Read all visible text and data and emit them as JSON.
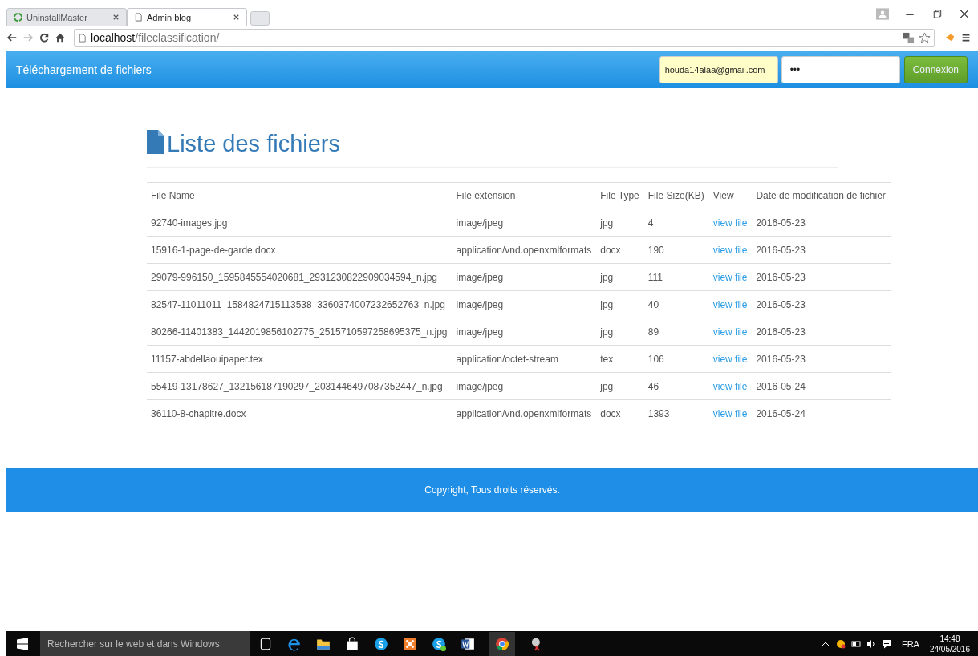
{
  "browser": {
    "tabs": [
      {
        "title": "UninstallMaster",
        "selected": false
      },
      {
        "title": "Admin blog",
        "selected": true
      }
    ],
    "address": {
      "host": "localhost",
      "path": "/fileclassification/"
    }
  },
  "navbar": {
    "brand": "Téléchargement de fichiers",
    "email": "houda14alaa@gmail.com",
    "password": "•••",
    "login_button": "Connexion"
  },
  "heading": "Liste des fichiers",
  "table": {
    "columns": [
      "File Name",
      "File extension",
      "File Type",
      "File Size(KB)",
      "View",
      "Date de modification de fichier"
    ],
    "rows": [
      [
        "92740-images.jpg",
        "image/jpeg",
        "jpg",
        "4",
        "view file",
        "2016-05-23"
      ],
      [
        "15916-1-page-de-garde.docx",
        "application/vnd.openxmlformats",
        "docx",
        "190",
        "view file",
        "2016-05-23"
      ],
      [
        "29079-996150_1595845554020681_2931230822909034594_n.jpg",
        "image/jpeg",
        "jpg",
        "111",
        "view file",
        "2016-05-23"
      ],
      [
        "82547-11011011_1584824715113538_3360374007232652763_n.jpg",
        "image/jpeg",
        "jpg",
        "40",
        "view file",
        "2016-05-23"
      ],
      [
        "80266-11401383_1442019856102775_2515710597258695375_n.jpg",
        "image/jpeg",
        "jpg",
        "89",
        "view file",
        "2016-05-23"
      ],
      [
        "11157-abdellaouipaper.tex",
        "application/octet-stream",
        "tex",
        "106",
        "view file",
        "2016-05-23"
      ],
      [
        "55419-13178627_132156187190297_2031446497087352447_n.jpg",
        "image/jpeg",
        "jpg",
        "46",
        "view file",
        "2016-05-24"
      ],
      [
        "36110-8-chapitre.docx",
        "application/vnd.openxmlformats",
        "docx",
        "1393",
        "view file",
        "2016-05-24"
      ]
    ]
  },
  "footer": "Copyright, Tous droits réservés.",
  "taskbar": {
    "search_placeholder": "Rechercher sur le web et dans Windows",
    "language": "FRA",
    "time": "14:48",
    "date": "24/05/2016"
  }
}
